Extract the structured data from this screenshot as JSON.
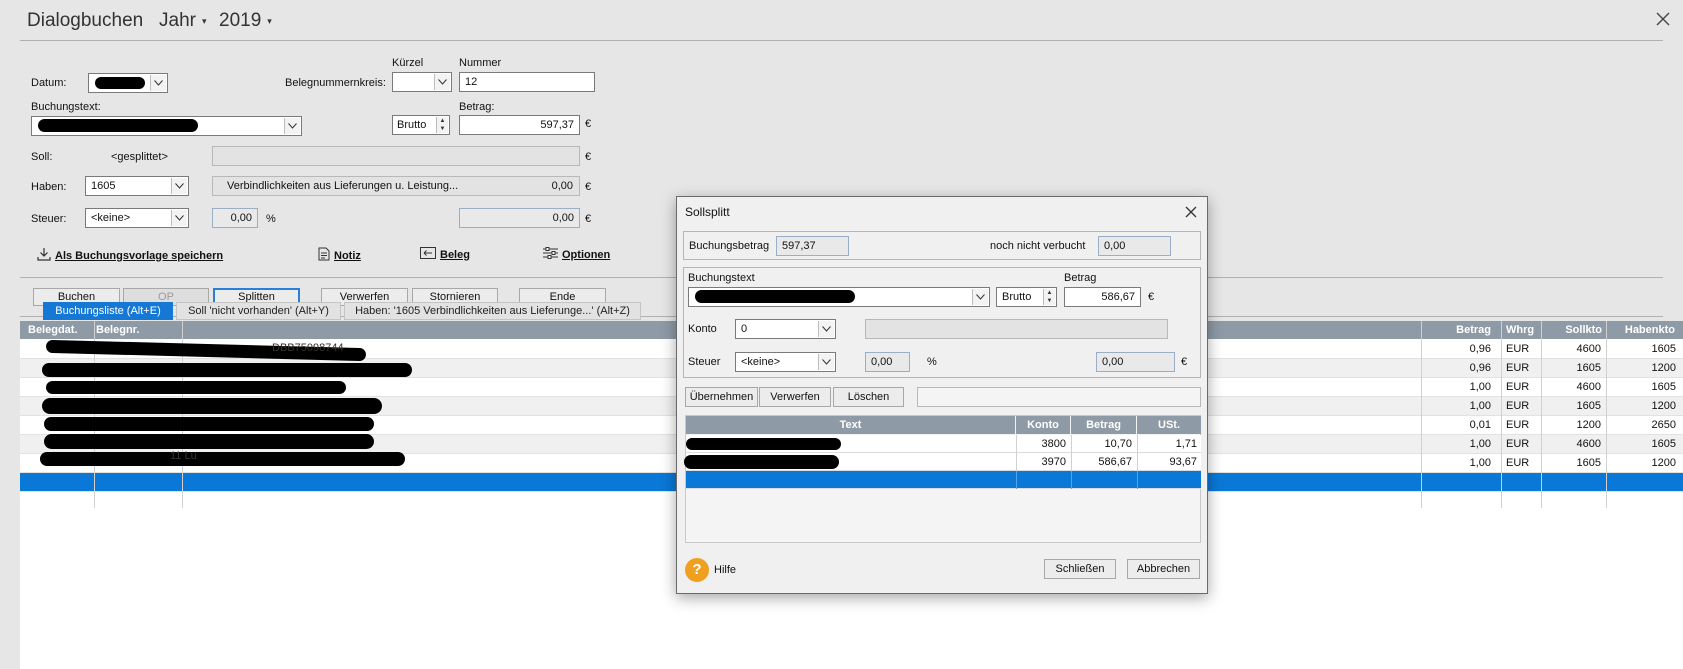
{
  "window": {
    "title": "Dialogbuchen",
    "period_label": "Jahr",
    "year": "2019"
  },
  "form": {
    "datum_label": "Datum:",
    "kuerzel_label": "Kürzel",
    "nummer_label": "Nummer",
    "belegnummernkreis_label": "Belegnummernkreis:",
    "nummer_value": "12",
    "buchungstext_label": "Buchungstext:",
    "betrag_label": "Betrag:",
    "brutto_value": "Brutto",
    "betrag_value": "597,37",
    "currency": "€",
    "soll_label": "Soll:",
    "soll_value": "<gesplittet>",
    "haben_label": "Haben:",
    "haben_value": "1605",
    "haben_desc": "Verbindlichkeiten aus Lieferungen u. Leistung...",
    "haben_amount": "0,00",
    "steuer_label": "Steuer:",
    "steuer_value": "<keine>",
    "steuer_rate": "0,00",
    "percent": "%",
    "steuer_amount": "0,00"
  },
  "links": {
    "vorlage": "Als Buchungsvorlage speichern",
    "notiz": "Notiz",
    "beleg": "Beleg",
    "optionen": "Optionen"
  },
  "buttons": {
    "buchen": "Buchen",
    "op": "OP",
    "splitten": "Splitten",
    "verwerfen": "Verwerfen",
    "stornieren": "Stornieren",
    "ende": "Ende"
  },
  "tabs": [
    "Buchungsliste (Alt+E)",
    "Soll 'nicht vorhanden' (Alt+Y)",
    "Haben: '1605 Verbindlichkeiten aus Lieferunge...' (Alt+Z)"
  ],
  "table": {
    "headers": {
      "belegdat": "Belegdat.",
      "belegnr": "Belegnr.",
      "betrag": "Betrag",
      "whrg": "Whrg",
      "sollkto": "Sollkto",
      "habenkto": "Habenkto"
    },
    "rows": [
      {
        "betrag": "0,96",
        "whrg": "EUR",
        "sollkto": "4600",
        "habenkto": "1605"
      },
      {
        "betrag": "0,96",
        "whrg": "EUR",
        "sollkto": "1605",
        "habenkto": "1200"
      },
      {
        "betrag": "1,00",
        "whrg": "EUR",
        "sollkto": "4600",
        "habenkto": "1605"
      },
      {
        "betrag": "1,00",
        "whrg": "EUR",
        "sollkto": "1605",
        "habenkto": "1200"
      },
      {
        "betrag": "0,01",
        "whrg": "EUR",
        "sollkto": "1200",
        "habenkto": "2650"
      },
      {
        "betrag": "1,00",
        "whrg": "EUR",
        "sollkto": "4600",
        "habenkto": "1605"
      },
      {
        "betrag": "1,00",
        "whrg": "EUR",
        "sollkto": "1605",
        "habenkto": "1200"
      }
    ],
    "fragments": {
      "row0_text": "DBB75098744",
      "row6_text": "11 Lu"
    }
  },
  "dialog": {
    "title": "Sollsplitt",
    "buchungsbetrag_label": "Buchungsbetrag",
    "buchungsbetrag_value": "597,37",
    "noch_label": "noch nicht verbucht",
    "noch_value": "0,00",
    "buchungstext_label": "Buchungstext",
    "betrag_label": "Betrag",
    "brutto": "Brutto",
    "betrag_value": "586,67",
    "currency": "€",
    "konto_label": "Konto",
    "konto_value": "0",
    "steuer_label": "Steuer",
    "steuer_value": "<keine>",
    "steuer_rate": "0,00",
    "percent": "%",
    "steuer_amount": "0,00",
    "btn_uebernehmen": "Übernehmen",
    "btn_verwerfen": "Verwerfen",
    "btn_loeschen": "Löschen",
    "grid_headers": {
      "text": "Text",
      "konto": "Konto",
      "betrag": "Betrag",
      "ust": "USt."
    },
    "rows": [
      {
        "konto": "3800",
        "betrag": "10,70",
        "ust": "1,71"
      },
      {
        "konto": "3970",
        "betrag": "586,67",
        "ust": "93,67"
      }
    ],
    "hilfe": "Hilfe",
    "btn_schliessen": "Schließen",
    "btn_abbrechen": "Abbrechen"
  },
  "colors": {
    "accent": "#1478d4",
    "header_bg": "#8e9aa6",
    "help_icon": "#f0a020"
  }
}
